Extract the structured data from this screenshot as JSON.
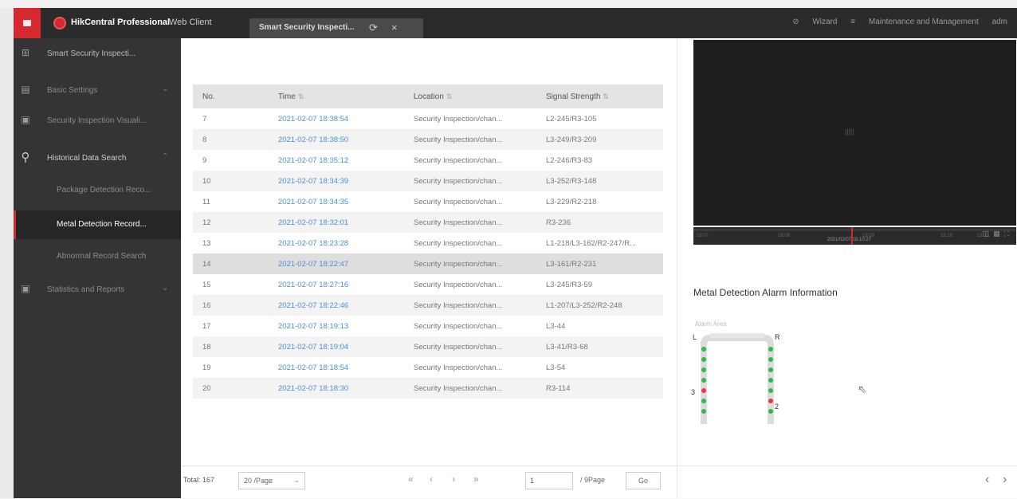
{
  "header": {
    "app_title": "HikCentral Professional",
    "app_subtitle": "Web Client",
    "tab_label": "Smart Security Inspecti...",
    "wizard": "Wizard",
    "maintenance": "Maintenance and Management",
    "user": "adm"
  },
  "sidebar": {
    "module": "Smart Security Inspecti...",
    "items": [
      {
        "label": "Basic Settings"
      },
      {
        "label": "Security Inspection Visuali..."
      },
      {
        "label": "Historical Data Search"
      },
      {
        "label": "Package Detection Reco..."
      },
      {
        "label": "Metal Detection Record..."
      },
      {
        "label": "Abnormal Record Search"
      },
      {
        "label": "Statistics and Reports"
      }
    ]
  },
  "table": {
    "columns": {
      "no": "No.",
      "time": "Time",
      "location": "Location",
      "signal": "Signal Strength"
    },
    "rows": [
      {
        "no": "7",
        "time": "2021-02-07 18:38:54",
        "location": "Security Inspection/chan...",
        "signal": "L2-245/R3-105"
      },
      {
        "no": "8",
        "time": "2021-02-07 18:38:50",
        "location": "Security Inspection/chan...",
        "signal": "L3-249/R3-209"
      },
      {
        "no": "9",
        "time": "2021-02-07 18:35:12",
        "location": "Security Inspection/chan...",
        "signal": "L2-246/R3-83"
      },
      {
        "no": "10",
        "time": "2021-02-07 18:34:39",
        "location": "Security Inspection/chan...",
        "signal": "L3-252/R3-148"
      },
      {
        "no": "11",
        "time": "2021-02-07 18:34:35",
        "location": "Security Inspection/chan...",
        "signal": "L3-229/R2-218"
      },
      {
        "no": "12",
        "time": "2021-02-07 18:32:01",
        "location": "Security Inspection/chan...",
        "signal": "R3-236"
      },
      {
        "no": "13",
        "time": "2021-02-07 18:23:28",
        "location": "Security Inspection/chan...",
        "signal": "L1-218/L3-162/R2-247/R..."
      },
      {
        "no": "14",
        "time": "2021-02-07 18:22:47",
        "location": "Security Inspection/chan...",
        "signal": "L3-161/R2-231"
      },
      {
        "no": "15",
        "time": "2021-02-07 18:27:16",
        "location": "Security Inspection/chan...",
        "signal": "L3-245/R3-59"
      },
      {
        "no": "16",
        "time": "2021-02-07 18:22:46",
        "location": "Security Inspection/chan...",
        "signal": "L1-207/L3-252/R2-248"
      },
      {
        "no": "17",
        "time": "2021-02-07 18:19:13",
        "location": "Security Inspection/chan...",
        "signal": "L3-44"
      },
      {
        "no": "18",
        "time": "2021-02-07 18:19:04",
        "location": "Security Inspection/chan...",
        "signal": "L3-41/R3-68"
      },
      {
        "no": "19",
        "time": "2021-02-07 18:18:54",
        "location": "Security Inspection/chan...",
        "signal": "L3-54"
      },
      {
        "no": "20",
        "time": "2021-02-07 18:18:30",
        "location": "Security Inspection/chan...",
        "signal": "R3-114"
      }
    ]
  },
  "pager": {
    "total": "Total: 167",
    "page_size": "20 /Page",
    "current_page": "1",
    "page_count": "/ 9Page",
    "go": "Go"
  },
  "right": {
    "video_msg": "|||||",
    "timeline_ticks": [
      "16:07",
      "18:08",
      "18:09",
      "18:10",
      "18:11"
    ],
    "cursor_time": "2021/02/07 18:10:27",
    "alarm_title": "Metal Detection Alarm Information",
    "alarm_zone_label": "Alarm Area",
    "gate": {
      "left": "L",
      "right": "R",
      "zone_left": "3",
      "zone_right": "2"
    }
  },
  "colors": {
    "accent": "#d7282f",
    "link": "#4a8fd6",
    "green": "#35b54a",
    "red": "#e0393e"
  }
}
